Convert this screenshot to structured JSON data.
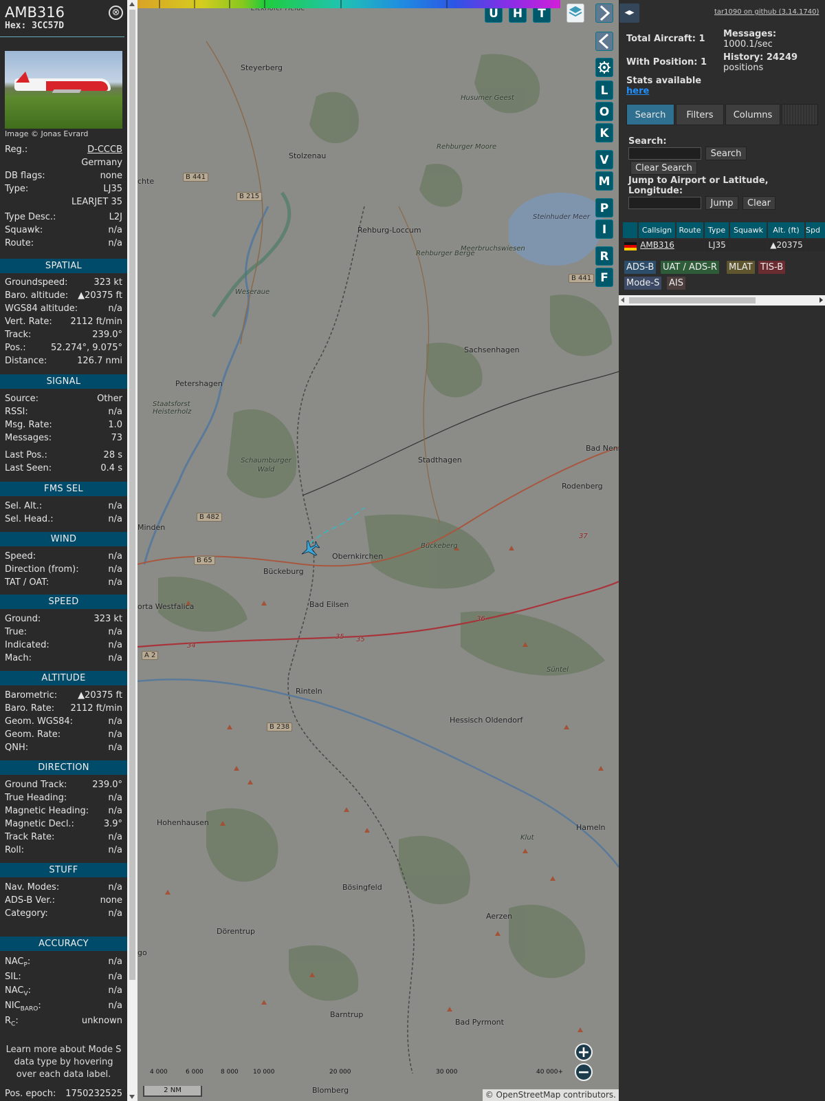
{
  "aircraft": {
    "callsign": "AMB316",
    "hex_label": "Hex:",
    "hex": "3CC57D",
    "photo_credit": "Image © Jonas Evrard",
    "close_glyph": "⊗"
  },
  "info_rows": {
    "reg": {
      "label": "Reg.:",
      "value": "D-CCCB"
    },
    "country": {
      "value": "Germany"
    },
    "db_flags": {
      "label": "DB flags:",
      "value": "none"
    },
    "type": {
      "label": "Type:",
      "value": "LJ35"
    },
    "type_full": {
      "value": "LEARJET 35"
    },
    "type_desc": {
      "label": "Type Desc.:",
      "value": "L2J"
    },
    "squawk": {
      "label": "Squawk:",
      "value": "n/a"
    },
    "route": {
      "label": "Route:",
      "value": "n/a"
    }
  },
  "spatial": {
    "header": "SPATIAL",
    "groundspeed": {
      "label": "Groundspeed:",
      "value": "323 kt"
    },
    "baro_alt": {
      "label": "Baro. altitude:",
      "value": "▲20375 ft"
    },
    "wgs84_alt": {
      "label": "WGS84 altitude:",
      "value": "n/a"
    },
    "vert_rate": {
      "label": "Vert. Rate:",
      "value": "2112 ft/min"
    },
    "track": {
      "label": "Track:",
      "value": "239.0°"
    },
    "pos": {
      "label": "Pos.:",
      "value": "52.274°, 9.075°"
    },
    "distance": {
      "label": "Distance:",
      "value": "126.7 nmi"
    }
  },
  "signal": {
    "header": "SIGNAL",
    "source": {
      "label": "Source:",
      "value": "Other"
    },
    "rssi": {
      "label": "RSSI:",
      "value": "n/a"
    },
    "msg_rate": {
      "label": "Msg. Rate:",
      "value": "1.0"
    },
    "messages": {
      "label": "Messages:",
      "value": "73"
    },
    "last_pos": {
      "label": "Last Pos.:",
      "value": "28 s"
    },
    "last_seen": {
      "label": "Last Seen:",
      "value": "0.4 s"
    }
  },
  "fms": {
    "header": "FMS SEL",
    "sel_alt": {
      "label": "Sel. Alt.:",
      "value": "n/a"
    },
    "sel_head": {
      "label": "Sel. Head.:",
      "value": "n/a"
    }
  },
  "wind": {
    "header": "WIND",
    "speed": {
      "label": "Speed:",
      "value": "n/a"
    },
    "direction": {
      "label": "Direction (from):",
      "value": "n/a"
    },
    "tat_oat": {
      "label": "TAT / OAT:",
      "value": "n/a"
    }
  },
  "speed": {
    "header": "SPEED",
    "ground": {
      "label": "Ground:",
      "value": "323 kt"
    },
    "true": {
      "label": "True:",
      "value": "n/a"
    },
    "indicated": {
      "label": "Indicated:",
      "value": "n/a"
    },
    "mach": {
      "label": "Mach:",
      "value": "n/a"
    }
  },
  "altitude": {
    "header": "ALTITUDE",
    "barometric": {
      "label": "Barometric:",
      "value": "▲20375 ft"
    },
    "baro_rate": {
      "label": "Baro. Rate:",
      "value": "2112 ft/min"
    },
    "geom_wgs84": {
      "label": "Geom. WGS84:",
      "value": "n/a"
    },
    "geom_rate": {
      "label": "Geom. Rate:",
      "value": "n/a"
    },
    "qnh": {
      "label": "QNH:",
      "value": "n/a"
    }
  },
  "direction": {
    "header": "DIRECTION",
    "ground_track": {
      "label": "Ground Track:",
      "value": "239.0°"
    },
    "true_heading": {
      "label": "True Heading:",
      "value": "n/a"
    },
    "mag_heading": {
      "label": "Magnetic Heading:",
      "value": "n/a"
    },
    "mag_decl": {
      "label": "Magnetic Decl.:",
      "value": "3.9°"
    },
    "track_rate": {
      "label": "Track Rate:",
      "value": "n/a"
    },
    "roll": {
      "label": "Roll:",
      "value": "n/a"
    }
  },
  "stuff": {
    "header": "STUFF",
    "nav_modes": {
      "label": "Nav. Modes:",
      "value": "n/a"
    },
    "adsb_ver": {
      "label": "ADS-B Ver.:",
      "value": "none"
    },
    "category": {
      "label": "Category:",
      "value": "n/a"
    }
  },
  "accuracy": {
    "header": "ACCURACY",
    "nacp": {
      "label": "NAC",
      "sub": "P",
      "suffix": ":",
      "value": "n/a"
    },
    "sil": {
      "label": "SIL:",
      "value": "n/a"
    },
    "nacv": {
      "label": "NAC",
      "sub": "V",
      "suffix": ":",
      "value": "n/a"
    },
    "nicbaro": {
      "label": "NIC",
      "sub": "BARO",
      "suffix": ":",
      "value": "n/a"
    },
    "rc": {
      "label": "R",
      "sub": "C",
      "suffix": ":",
      "value": "unknown"
    }
  },
  "learn_more": "Learn more about Mode S data type by hovering over each data label.",
  "pos_epoch": {
    "label": "Pos. epoch:",
    "value": "1750232525"
  },
  "map": {
    "buttons_top": {
      "u": "U",
      "h": "H",
      "t": "T"
    },
    "side_buttons": {
      "l": "L",
      "o": "O",
      "k": "K",
      "v": "V",
      "m": "M",
      "p": "P",
      "i": "I",
      "r": "R",
      "f": "F"
    },
    "places": {
      "eickhofer_heide": "Eickhofer Heide",
      "steyerberg": "Steyerberg",
      "stolzenau": "Stolzenau",
      "rehburg_loccum": "Rehburg-Loccum",
      "husumer_geest": "Husumer Geest",
      "rehburger_moore": "Rehburger Moore",
      "steinhuder_meer": "Steinhuder Meer",
      "meerbruchswiesen": "Meerbruchswiesen",
      "rehburger_berge": "Rehburger Berge",
      "weseraue": "Weseraue",
      "sachsenhagen": "Sachsenhagen",
      "petershagen": "Petershagen",
      "staatsforst": "Staatsforst Heisterholz",
      "schaumburger_wald": "Schaumburger Wald",
      "stadthagen": "Stadthagen",
      "bad_nenndorf": "Bad Nenn",
      "rodenberg": "Rodenberg",
      "minden": "Minden",
      "buckeberg": "Bückeberg",
      "obernkirchen": "Obernkirchen",
      "bueckeburg": "Bückeburg",
      "bad_eilsen": "Bad Eilsen",
      "porta_westfalica": "orta Westfalica",
      "rinteln": "Rinteln",
      "suntel": "Süntel",
      "hessisch_oldendorf": "Hessisch Oldendorf",
      "hohenhausen": "Hohenhausen",
      "klut": "Klut",
      "hameln": "Hameln",
      "boesingfeld": "Bösingfeld",
      "aerzen": "Aerzen",
      "doerentrup": "Dörentrup",
      "lemgo": "go",
      "barntrup": "Barntrup",
      "bad_pyrmont": "Bad Pyrmont",
      "blomberg": "Blomberg",
      "echte": "chte"
    },
    "roads": {
      "b441a": "B 441",
      "b215": "B 215",
      "b441b": "B 441",
      "b482": "B 482",
      "b65": "B 65",
      "a2": "A 2",
      "b238": "B 238",
      "r37": "37",
      "r36": "36",
      "r35a": "35",
      "r35b": "35",
      "r34": "34"
    },
    "altitude_labels": [
      "4 000",
      "6 000",
      "8 000",
      "10 000",
      "20 000",
      "30 000",
      "40 000+"
    ],
    "scale": "2 NM",
    "attribution": "© OpenStreetMap contributors.",
    "zoom_in": "+",
    "zoom_out": "−"
  },
  "sidebar": {
    "toggle_glyph": "◂▸",
    "github": "tar1090 on github (3.14.1740)",
    "total_aircraft": "Total Aircraft: 1",
    "messages_label": "Messages:",
    "messages_value": "1000.1/sec",
    "with_position": "With Position: 1",
    "history_label": "History: 24249",
    "history_value": "positions",
    "stats_label": "Stats available",
    "stats_link": "here",
    "tabs": {
      "search": "Search",
      "filters": "Filters",
      "columns": "Columns"
    },
    "search_label": "Search:",
    "search_value": "",
    "search_button": "Search",
    "clear_search_button": "Clear Search",
    "jump_label": "Jump to Airport or Latitude, Longitude:",
    "jump_value": "",
    "jump_button": "Jump",
    "clear_button": "Clear",
    "table": {
      "headers": [
        "Callsign",
        "Route",
        "Type",
        "Squawk",
        "Alt. (ft)",
        "Spd"
      ],
      "row": {
        "callsign": "AMB316",
        "route": "",
        "type": "LJ35",
        "squawk": "",
        "alt": "▲20375",
        "spd": ""
      }
    },
    "legend": {
      "adsb": "ADS-B",
      "uat": "UAT / ADS-R",
      "mlat": "MLAT",
      "tisb": "TIS-B",
      "modes": "Mode-S",
      "ais": "AIS"
    }
  },
  "colors": {
    "section_header": "#004a6a",
    "button_teal": "#00596b",
    "legend_adsb": "#2d4e6b",
    "legend_uat": "#2e5c38",
    "legend_mlat": "#5f5630",
    "legend_tisb": "#6a2c30",
    "legend_modes": "#3d4a66",
    "legend_ais": "#4d3e3e"
  }
}
